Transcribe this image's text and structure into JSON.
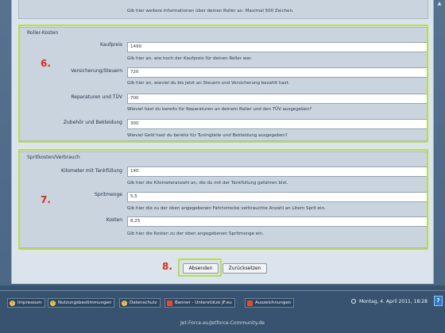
{
  "top_form": {
    "help": "Gib hier weitere Informationen über deinen Roller an. Maximal 500 Zeichen."
  },
  "roller_kosten": {
    "legend": "Roller-Kosten",
    "step": "6.",
    "rows": [
      {
        "label": "Kaufpreis",
        "value": "1499",
        "help": "Gib hier an, wie hoch der Kaufpreis für deinen Roller war."
      },
      {
        "label": "Versicherung/Steuern",
        "value": "720",
        "help": "Gib hier an, wieviel du bis jetzt an Steuern und Versicherung bezahlt hast."
      },
      {
        "label": "Reparaturen und TÜV",
        "value": "700",
        "help": "Wieviel hast du bereits für Reparaturen an deinem Roller und den TÜV ausgegeben?"
      },
      {
        "label": "Zubehör und Bekleidung",
        "value": "300",
        "help": "Wieviel Geld hast du bereits für Tuningteile und Bekleidung ausgegeben?"
      }
    ]
  },
  "spritkosten": {
    "legend": "Spritkosten/Verbrauch",
    "step": "7.",
    "rows": [
      {
        "label": "Kilometer mit Tankfüllung",
        "value": "140",
        "help": "Gib hier die Kilometeranzahl an, die du mit der Tankfüllung gefahren bist."
      },
      {
        "label": "Spritmenge",
        "value": "5,5",
        "help": "Gib hier die zu der oben angegebenen Fahrtstrecke verbrauchte Anzahl an Litern Sprit ein."
      },
      {
        "label": "Kosten",
        "value": "8,25",
        "help": "Gib hier die Kosten zu der oben angegebenen Spritmenge ein."
      }
    ]
  },
  "buttons": {
    "step": "8.",
    "submit": "Absenden",
    "reset": "Zurücksetzen"
  },
  "footer": {
    "links": [
      "Impressum",
      "Nutzungsbestimmungen",
      "Datenschutz",
      "Banner - Unterstütze JF.eu",
      "Auszeichnungen"
    ],
    "date": "Montag, 4. April 2011, 18:28",
    "help": "?",
    "copyright": "Jet-Force.eu/Jetforce-Community.de",
    "scroll": "▲"
  },
  "colors": {
    "highlight": "#b7db54",
    "step_number": "#d92c1c"
  },
  "icons": [
    "info-icon",
    "document-icon",
    "clock-icon",
    "help-icon",
    "scroll-up-icon"
  ]
}
